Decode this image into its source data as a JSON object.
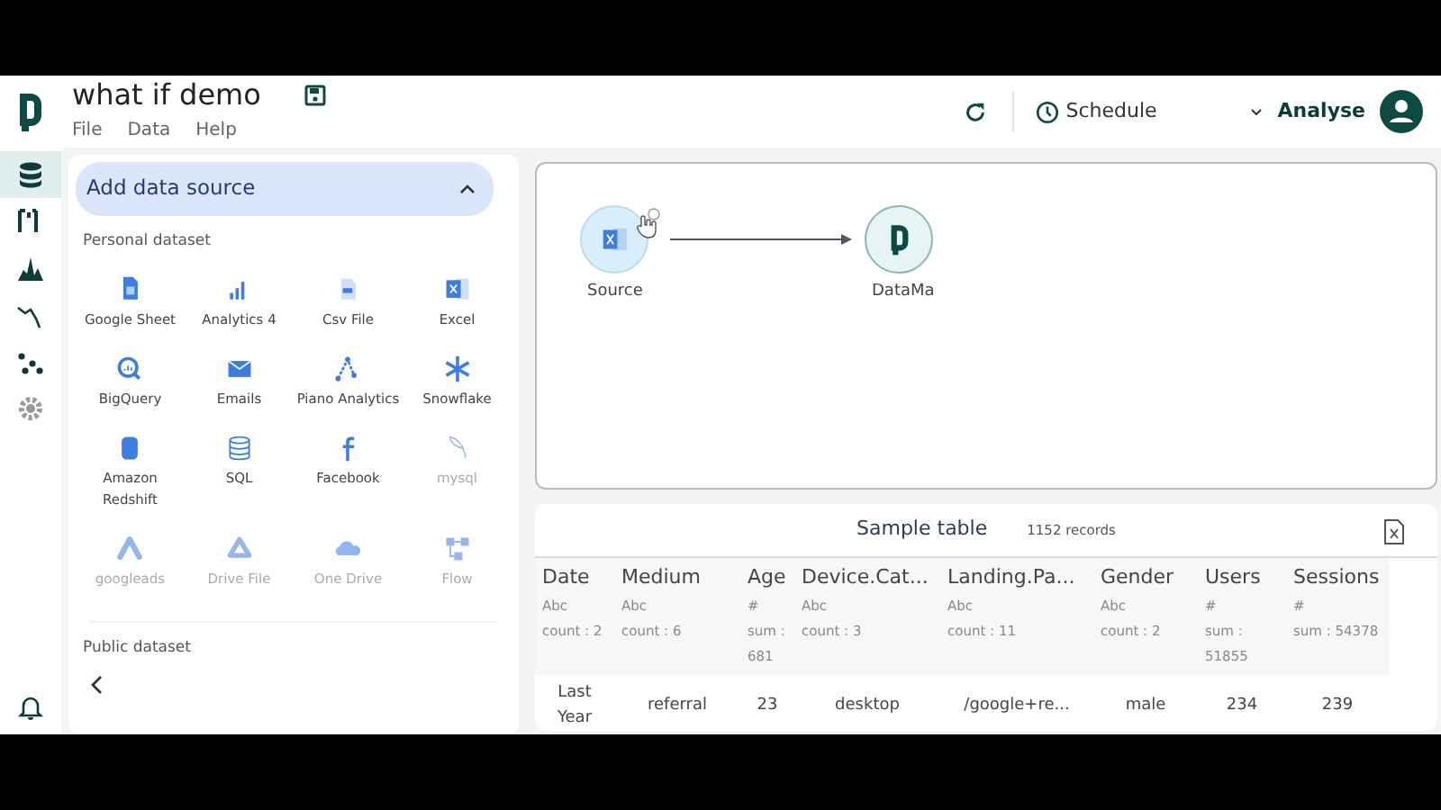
{
  "app": {
    "title": "what if demo",
    "menu": [
      "File",
      "Data",
      "Help"
    ]
  },
  "toolbar": {
    "schedule": "Schedule",
    "analyse": "Analyse"
  },
  "rail": [
    {
      "selected": true
    },
    {
      "selected": false
    },
    {
      "selected": false
    },
    {
      "selected": false
    },
    {
      "selected": false
    },
    {
      "selected": false
    }
  ],
  "panel": {
    "title": "Add data source",
    "expanded": true,
    "personal_label": "Personal dataset",
    "sources": [
      {
        "label": "Google Sheet",
        "disabled": false
      },
      {
        "label": "Analytics 4",
        "disabled": false
      },
      {
        "label": "Csv File",
        "disabled": false
      },
      {
        "label": "Excel",
        "disabled": false
      },
      {
        "label": "BigQuery",
        "disabled": false
      },
      {
        "label": "Emails",
        "disabled": false
      },
      {
        "label": "Piano Analytics",
        "disabled": false
      },
      {
        "label": "Snowflake",
        "disabled": false
      },
      {
        "label": "Amazon Redshift",
        "disabled": false
      },
      {
        "label": "SQL",
        "disabled": false
      },
      {
        "label": "Facebook",
        "disabled": false
      },
      {
        "label": "mysql",
        "disabled": true
      },
      {
        "label": "googleads",
        "disabled": true
      },
      {
        "label": "Drive File",
        "disabled": true
      },
      {
        "label": "One Drive",
        "disabled": true
      },
      {
        "label": "Flow",
        "disabled": true
      }
    ],
    "public_label": "Public dataset"
  },
  "canvas": {
    "nodes": [
      {
        "label": "Source"
      },
      {
        "label": "DataMa"
      }
    ]
  },
  "table": {
    "title": "Sample table",
    "records": "1152 records",
    "columns": [
      {
        "name": "Date",
        "type": "Abc",
        "stat": "count : 2"
      },
      {
        "name": "Medium",
        "type": "Abc",
        "stat": "count : 6"
      },
      {
        "name": "Age",
        "type": "#",
        "stat": "sum : 681"
      },
      {
        "name": "Device.Cat...",
        "type": "Abc",
        "stat": "count : 3"
      },
      {
        "name": "Landing.Pa...",
        "type": "Abc",
        "stat": "count : 11"
      },
      {
        "name": "Gender",
        "type": "Abc",
        "stat": "count : 2"
      },
      {
        "name": "Users",
        "type": "#",
        "stat": "sum : 51855"
      },
      {
        "name": "Sessions",
        "type": "#",
        "stat": "sum : 54378"
      }
    ],
    "rows": [
      [
        "Last Year",
        "referral",
        "23",
        "desktop",
        "/google+re...",
        "male",
        "234",
        "239"
      ]
    ]
  }
}
